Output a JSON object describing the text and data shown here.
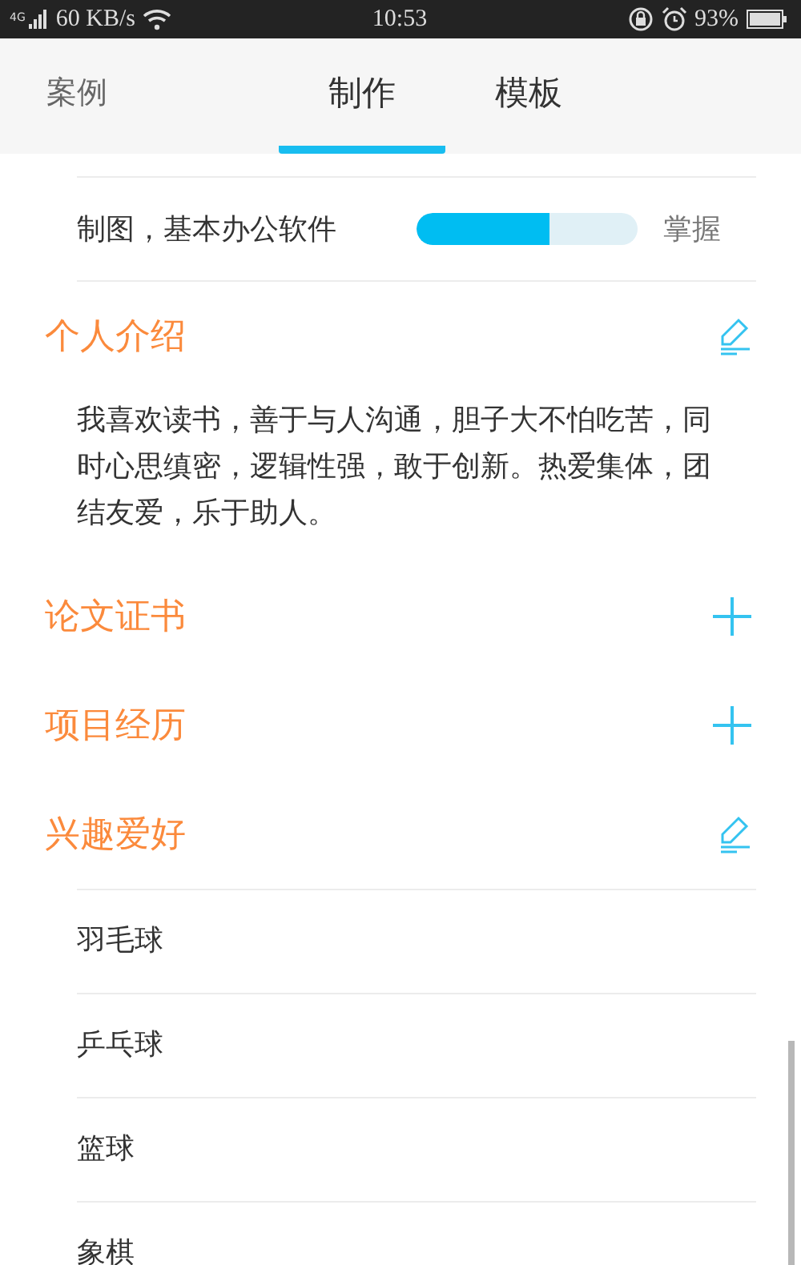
{
  "status_bar": {
    "network": "4G",
    "speed": "60 KB/s",
    "time": "10:53",
    "battery": "93%"
  },
  "tabs": [
    {
      "label": "案例",
      "selected": false
    },
    {
      "label": "制作",
      "selected": true
    },
    {
      "label": "模板",
      "selected": false
    }
  ],
  "skills": [
    {
      "name": "制图，基本办公软件",
      "level": 0.6,
      "grade": "掌握"
    }
  ],
  "sections": [
    {
      "title": "个人介绍",
      "kind": "edit",
      "text": "我喜欢读书，善于与人沟通，胆子大不怕吃苦，同时心思缜密，逻辑性强，敢于创新。热爱集体，团结友爱，乐于助人。"
    },
    {
      "title": "论文证书",
      "kind": "add"
    },
    {
      "title": "项目经历",
      "kind": "add"
    },
    {
      "title": "兴趣爱好",
      "kind": "edit",
      "items": [
        "羽毛球",
        "乒乓球",
        "篮球",
        "象棋"
      ]
    }
  ]
}
